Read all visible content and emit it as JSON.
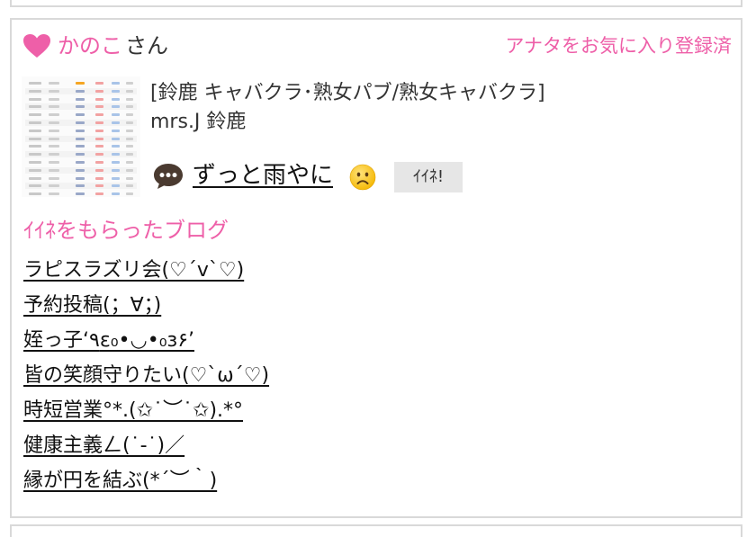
{
  "card": {
    "user_name": "かのこ",
    "user_suffix": "さん",
    "favorite_status": "アナタをお気に入り登録済",
    "shop_type": "[鈴鹿 キャバクラ･熟女パブ/熟女キャバクラ]",
    "shop_name": "mrs.J 鈴鹿",
    "post_title": "ずっと雨やに",
    "iine_label": "ｲｲﾈ!"
  },
  "blogs_section": {
    "title": "ｲｲﾈをもらったブログ",
    "items": [
      "ラピスラズリ会(♡´ᴠ`♡)",
      "予約投稿(；∀；)",
      "姪っ子‘٩ε₀•◡•₀з۶’",
      "皆の笑顔守りたい(♡`ω´♡)",
      "時短営業°*.(✩˙︶˙✩).*°",
      "健康主義ㄥ(˙-˙)／",
      "縁が円を結ぶ(*´︶｀)"
    ]
  },
  "colors": {
    "accent_pink": "#ee5fa8",
    "border": "#d9d9d9",
    "button_bg": "#e6e6e6"
  },
  "icons": {
    "heart": "heart-icon",
    "speech": "speech-bubble-icon",
    "sad": "sad-face-icon"
  }
}
